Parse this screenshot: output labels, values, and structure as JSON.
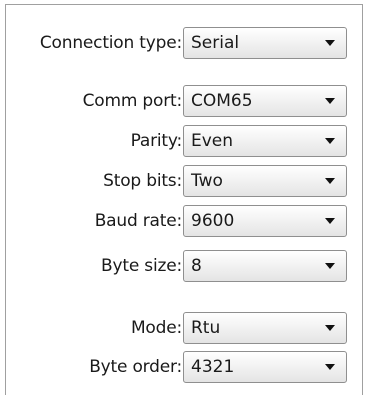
{
  "settings": {
    "connection_type": {
      "label": "Connection type:",
      "value": "Serial"
    },
    "comm_port": {
      "label": "Comm port:",
      "value": "COM65"
    },
    "parity": {
      "label": "Parity:",
      "value": "Even"
    },
    "stop_bits": {
      "label": "Stop bits:",
      "value": "Two"
    },
    "baud_rate": {
      "label": "Baud rate:",
      "value": "9600"
    },
    "byte_size": {
      "label": "Byte size:",
      "value": "8"
    },
    "mode": {
      "label": "Mode:",
      "value": "Rtu"
    },
    "byte_order": {
      "label": "Byte order:",
      "value": "4321"
    }
  },
  "icons": {
    "dropdown": "chevron-down-icon"
  }
}
